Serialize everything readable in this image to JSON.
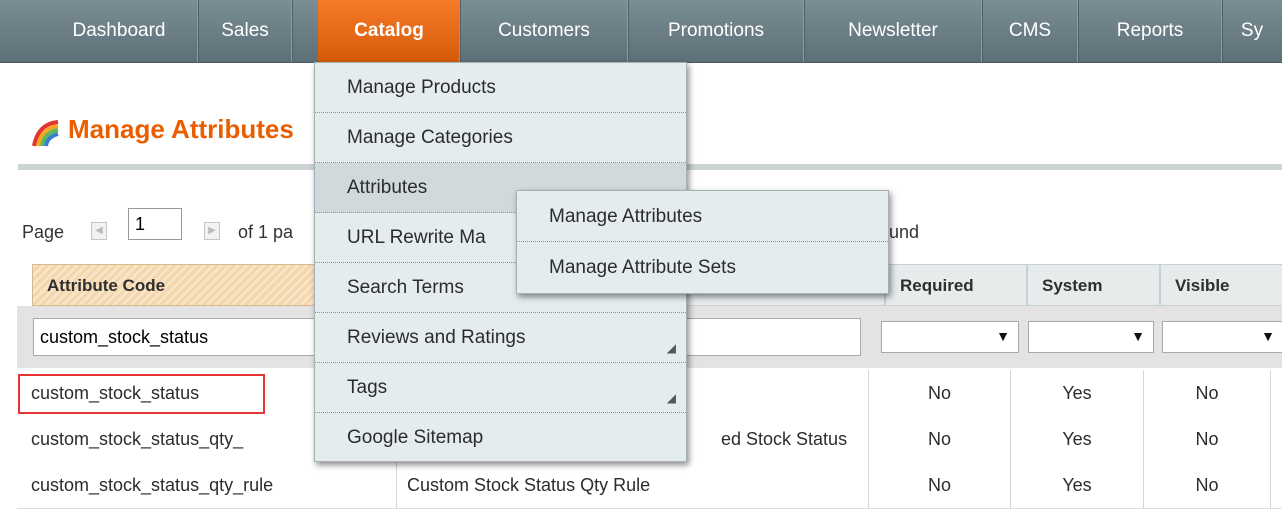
{
  "nav": {
    "items": [
      {
        "label": "Dashboard"
      },
      {
        "label": "Sales"
      },
      {
        "label": "Catalog",
        "active": true
      },
      {
        "label": "Customers"
      },
      {
        "label": "Promotions"
      },
      {
        "label": "Newsletter"
      },
      {
        "label": "CMS"
      },
      {
        "label": "Reports"
      },
      {
        "label": "Sy"
      }
    ]
  },
  "page": {
    "title": "Manage Attributes",
    "icon": "rainbow-icon"
  },
  "pager": {
    "page_label": "Page",
    "page_value": "1",
    "of_label": "of 1 pa",
    "found_label": "und"
  },
  "grid": {
    "headers": {
      "code": "Attribute Code",
      "required": "Required",
      "system": "System",
      "visible": "Visible"
    },
    "filter": {
      "code": "custom_stock_status"
    },
    "rows": [
      {
        "code": "custom_stock_status",
        "label": "",
        "required": "No",
        "system": "Yes",
        "visible": "No"
      },
      {
        "code": "custom_stock_status_qty_",
        "label": "ed Stock Status",
        "required": "No",
        "system": "Yes",
        "visible": "No"
      },
      {
        "code": "custom_stock_status_qty_rule",
        "label": "Custom Stock Status Qty Rule",
        "required": "No",
        "system": "Yes",
        "visible": "No"
      }
    ]
  },
  "menu": {
    "items": [
      {
        "label": "Manage Products"
      },
      {
        "label": "Manage Categories"
      },
      {
        "label": "Attributes"
      },
      {
        "label": "URL Rewrite Ma"
      },
      {
        "label": "Search Terms"
      },
      {
        "label": "Reviews and Ratings"
      },
      {
        "label": "Tags"
      },
      {
        "label": "Google Sitemap"
      }
    ]
  },
  "submenu": {
    "items": [
      {
        "label": "Manage Attributes"
      },
      {
        "label": "Manage Attribute Sets"
      }
    ]
  },
  "colors": {
    "accent": "#eb5e00",
    "nav_bg": "#6a7d85",
    "highlight": "#e53535"
  }
}
